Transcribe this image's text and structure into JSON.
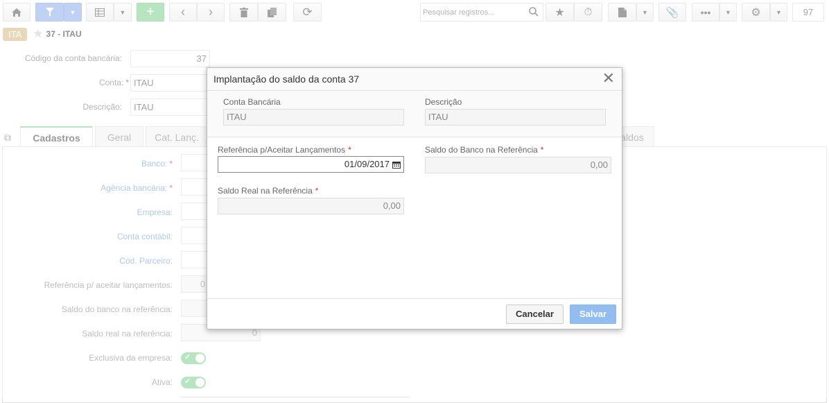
{
  "toolbar": {
    "search_placeholder": "Pesquisar registros...",
    "record_count": "97"
  },
  "breadcrumb": {
    "badge": "ITA",
    "title": "37 - ITAU"
  },
  "form": {
    "codigo_label": "Código da conta bancária:",
    "codigo_value": "37",
    "conta_label": "Conta:",
    "conta_value": "ITAU",
    "descricao_label": "Descrição:",
    "descricao_value": "ITAU"
  },
  "tabs": [
    {
      "label": "Cadastros"
    },
    {
      "label": "Geral"
    },
    {
      "label": "Cat. Lanç."
    },
    {
      "label": "aldos"
    }
  ],
  "panel": {
    "banco_label": "Banco:",
    "agencia_label": "Agência bancária:",
    "empresa_label": "Empresa:",
    "conta_contabil_label": "Conta contábil:",
    "cod_parceiro_label": "Cód. Parceiro:",
    "ref_label": "Referência p/ aceitar lançamentos:",
    "ref_value": "0",
    "saldo_banco_label": "Saldo do banco na referência:",
    "saldo_real_label": "Saldo real na referência:",
    "saldo_real_value": "0",
    "exclusiva_label": "Exclusiva da empresa:",
    "ativa_label": "Ativa:"
  },
  "modal": {
    "title": "Implantação do saldo da conta 37",
    "conta_bancaria_label": "Conta Bancária",
    "conta_bancaria_value": "ITAU",
    "descricao_label": "Descrição",
    "descricao_value": "ITAU",
    "referencia_label": "Referência p/Aceitar Lançamentos",
    "referencia_value": "01/09/2017",
    "saldo_banco_label": "Saldo do Banco na Referência",
    "saldo_banco_value": "0,00",
    "saldo_real_label": "Saldo Real na Referência",
    "saldo_real_value": "0,00",
    "cancel_label": "Cancelar",
    "save_label": "Salvar"
  },
  "colors": {
    "accent_green": "#7ccf8a",
    "accent_blue": "#8aaee9",
    "badge": "#d7b680",
    "required": "#cc3333"
  }
}
